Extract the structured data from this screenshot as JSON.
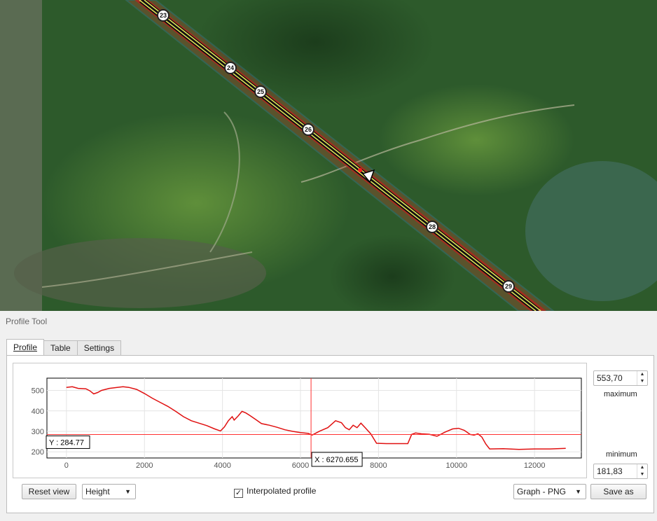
{
  "map": {
    "markers": [
      "23",
      "24",
      "25",
      "26",
      "28",
      "29"
    ]
  },
  "panel": {
    "title": "Profile Tool",
    "tabs": [
      {
        "label": "Profile",
        "active": true
      },
      {
        "label": "Table",
        "active": false
      },
      {
        "label": "Settings",
        "active": false
      }
    ]
  },
  "readouts": {
    "max_value": "553,70",
    "max_label": "maximum",
    "min_value": "181,83",
    "min_label": "minimum",
    "cursor_y": "Y : 284.77",
    "cursor_x": "X : 6270.655"
  },
  "controls": {
    "reset_view": "Reset view",
    "mode_select": "Height",
    "interpolated_label": "Interpolated profile",
    "interpolated_checked": true,
    "export_select": "Graph - PNG",
    "save_as": "Save as"
  },
  "chart_data": {
    "type": "line",
    "xlabel": "",
    "ylabel": "",
    "xlim": [
      -500,
      13200
    ],
    "ylim": [
      170,
      560
    ],
    "x_ticks": [
      0,
      2000,
      4000,
      6000,
      8000,
      10000,
      12000
    ],
    "y_ticks": [
      200,
      300,
      400,
      500
    ],
    "grid": true,
    "cursor": {
      "x": 6270.655,
      "y": 284.77
    },
    "series": [
      {
        "color": "#e01010",
        "points": [
          [
            0,
            515
          ],
          [
            150,
            518
          ],
          [
            300,
            510
          ],
          [
            500,
            508
          ],
          [
            600,
            498
          ],
          [
            700,
            483
          ],
          [
            800,
            490
          ],
          [
            900,
            500
          ],
          [
            1100,
            510
          ],
          [
            1300,
            515
          ],
          [
            1450,
            518
          ],
          [
            1600,
            515
          ],
          [
            1800,
            505
          ],
          [
            2000,
            485
          ],
          [
            2200,
            462
          ],
          [
            2400,
            442
          ],
          [
            2600,
            422
          ],
          [
            2800,
            398
          ],
          [
            3000,
            372
          ],
          [
            3200,
            352
          ],
          [
            3400,
            340
          ],
          [
            3600,
            328
          ],
          [
            3800,
            312
          ],
          [
            3950,
            302
          ],
          [
            4050,
            322
          ],
          [
            4150,
            352
          ],
          [
            4250,
            372
          ],
          [
            4300,
            355
          ],
          [
            4400,
            375
          ],
          [
            4500,
            398
          ],
          [
            4600,
            390
          ],
          [
            4700,
            378
          ],
          [
            4850,
            358
          ],
          [
            5000,
            338
          ],
          [
            5200,
            330
          ],
          [
            5400,
            320
          ],
          [
            5600,
            308
          ],
          [
            5800,
            300
          ],
          [
            6000,
            294
          ],
          [
            6200,
            290
          ],
          [
            6300,
            282
          ],
          [
            6400,
            292
          ],
          [
            6500,
            302
          ],
          [
            6700,
            318
          ],
          [
            6900,
            352
          ],
          [
            7050,
            342
          ],
          [
            7150,
            318
          ],
          [
            7250,
            308
          ],
          [
            7350,
            330
          ],
          [
            7450,
            318
          ],
          [
            7550,
            340
          ],
          [
            7650,
            320
          ],
          [
            7800,
            288
          ],
          [
            7950,
            242
          ],
          [
            8200,
            240
          ],
          [
            8500,
            240
          ],
          [
            8750,
            240
          ],
          [
            8850,
            285
          ],
          [
            8950,
            292
          ],
          [
            9100,
            288
          ],
          [
            9300,
            286
          ],
          [
            9500,
            276
          ],
          [
            9700,
            296
          ],
          [
            9900,
            312
          ],
          [
            10050,
            315
          ],
          [
            10200,
            305
          ],
          [
            10350,
            285
          ],
          [
            10450,
            282
          ],
          [
            10550,
            288
          ],
          [
            10650,
            272
          ],
          [
            10750,
            238
          ],
          [
            10850,
            214
          ],
          [
            11200,
            215
          ],
          [
            11600,
            212
          ],
          [
            12000,
            214
          ],
          [
            12400,
            214
          ],
          [
            12800,
            217
          ]
        ]
      }
    ]
  }
}
